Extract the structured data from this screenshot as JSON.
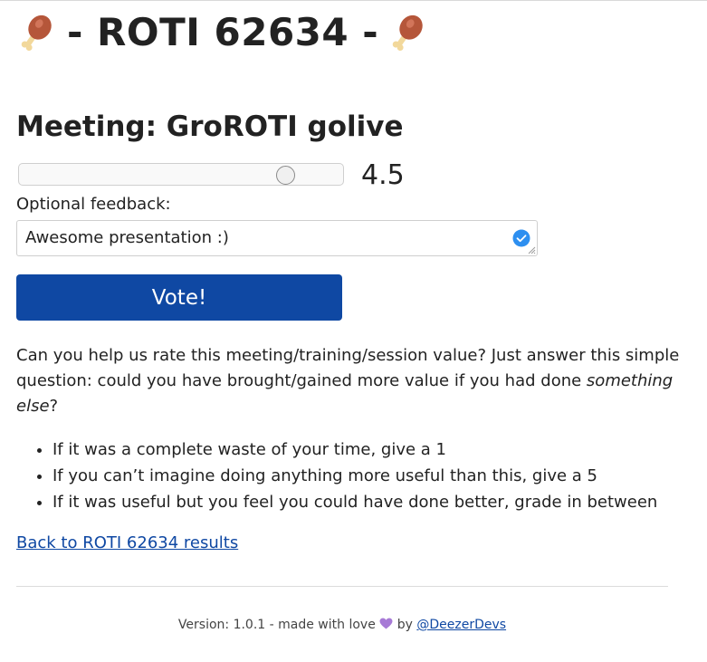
{
  "header": {
    "title": "- ROTI 62634 -",
    "left_icon": "meat-on-bone-icon",
    "right_icon": "meat-on-bone-icon"
  },
  "meeting": {
    "title": "Meeting: GroROTI golive"
  },
  "rating": {
    "value": 4.5,
    "min": 1,
    "max": 5,
    "display": "4.5"
  },
  "feedback": {
    "label": "Optional feedback:",
    "value": "Awesome presentation :)",
    "valid_icon": "check-circle-icon"
  },
  "vote_button": {
    "label": "Vote!"
  },
  "explanation": {
    "text_before_em": "Can you help us rate this meeting/training/session value? Just answer this simple question: could you have brought/gained more value if you had done ",
    "emphasis": "something else",
    "text_after_em": "?"
  },
  "rules": [
    "If it was a complete waste of your time, give a 1",
    "If you can’t imagine doing anything more useful than this, give a 5",
    "If it was useful but you feel you could have done better, grade in between"
  ],
  "back_link": {
    "label": "Back to ROTI 62634 results"
  },
  "footer": {
    "prefix": "Version: 1.0.1 - made with love",
    "heart_icon": "purple-heart-icon",
    "by": "by",
    "link": "@DeezerDevs"
  },
  "colors": {
    "primary": "#0f48a3",
    "check": "#2d8ff0",
    "heart": "#a77ad6"
  }
}
